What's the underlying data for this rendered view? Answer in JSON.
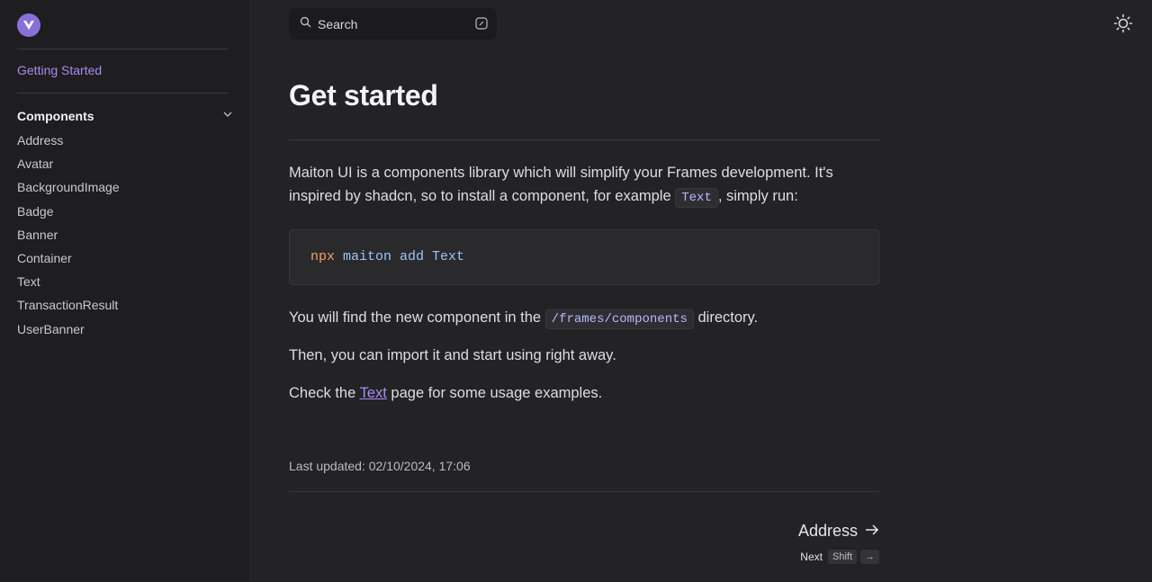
{
  "sidebar": {
    "getting_started": "Getting Started",
    "section_title": "Components",
    "items": [
      "Address",
      "Avatar",
      "BackgroundImage",
      "Badge",
      "Banner",
      "Container",
      "Text",
      "TransactionResult",
      "UserBanner"
    ]
  },
  "search": {
    "label": "Search"
  },
  "page": {
    "title": "Get started",
    "intro_1": "Maiton UI is a components library which will simplify your Frames development. It's inspired by shadcn, so to install a component, for example ",
    "intro_code": "Text",
    "intro_2": ", simply run:",
    "cmd": {
      "npx": "npx",
      "rest": "maiton add Text"
    },
    "dir_1": "You will find the new component in the ",
    "dir_code": "/frames/components",
    "dir_2": " directory.",
    "import_text": "Then, you can import it and start using right away.",
    "check_1": "Check the ",
    "check_link": "Text",
    "check_2": " page for some usage examples.",
    "last_updated": "Last updated: 02/10/2024, 17:06"
  },
  "pager": {
    "next_title": "Address",
    "next_label": "Next",
    "shift_key": "Shift",
    "arrow_key": "→"
  },
  "colors": {
    "accent": "#a98bf0",
    "background": "#232325",
    "sidebar": "#1e1e20"
  }
}
